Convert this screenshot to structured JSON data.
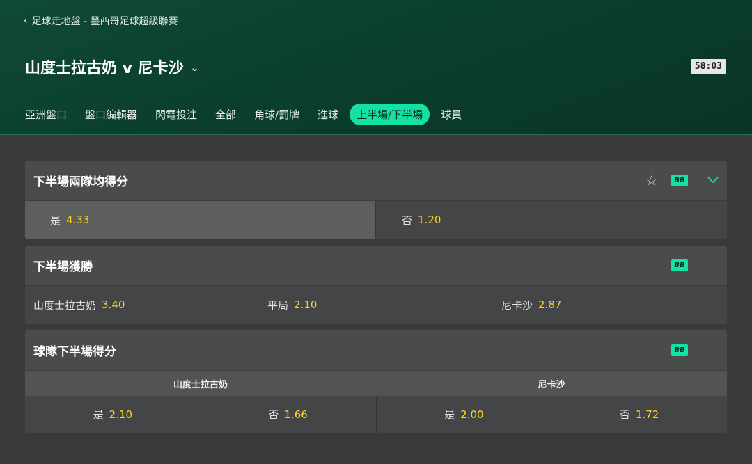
{
  "breadcrumb": {
    "label": "足球走地盤 - 墨西哥足球超級聯賽"
  },
  "match": {
    "title": "山度士拉古奶 v 尼卡沙",
    "clock": "58:03"
  },
  "tabs": [
    "亞洲盤口",
    "盤口編輯器",
    "閃電投注",
    "全部",
    "角球/罰牌",
    "進球",
    "上半場/下半場",
    "球員"
  ],
  "active_tab": "上半場/下半場",
  "markets": {
    "btts_2h": {
      "title": "下半場兩隊均得分",
      "badge": "BB",
      "yes_label": "是",
      "yes_odds": "4.33",
      "no_label": "否",
      "no_odds": "1.20"
    },
    "win_2h": {
      "title": "下半場獲勝",
      "badge": "BB",
      "home_label": "山度士拉古奶",
      "home_odds": "3.40",
      "draw_label": "平局",
      "draw_odds": "2.10",
      "away_label": "尼卡沙",
      "away_odds": "2.87"
    },
    "team_score_2h": {
      "title": "球隊下半場得分",
      "badge": "BB",
      "home_team": "山度士拉古奶",
      "away_team": "尼卡沙",
      "home_yes_label": "是",
      "home_yes_odds": "2.10",
      "home_no_label": "否",
      "home_no_odds": "1.66",
      "away_yes_label": "是",
      "away_yes_odds": "2.00",
      "away_no_label": "否",
      "away_no_odds": "1.72"
    }
  },
  "colors": {
    "accent": "#14e1a3",
    "odds": "#ffd21f",
    "header": "#0b3f2d"
  }
}
